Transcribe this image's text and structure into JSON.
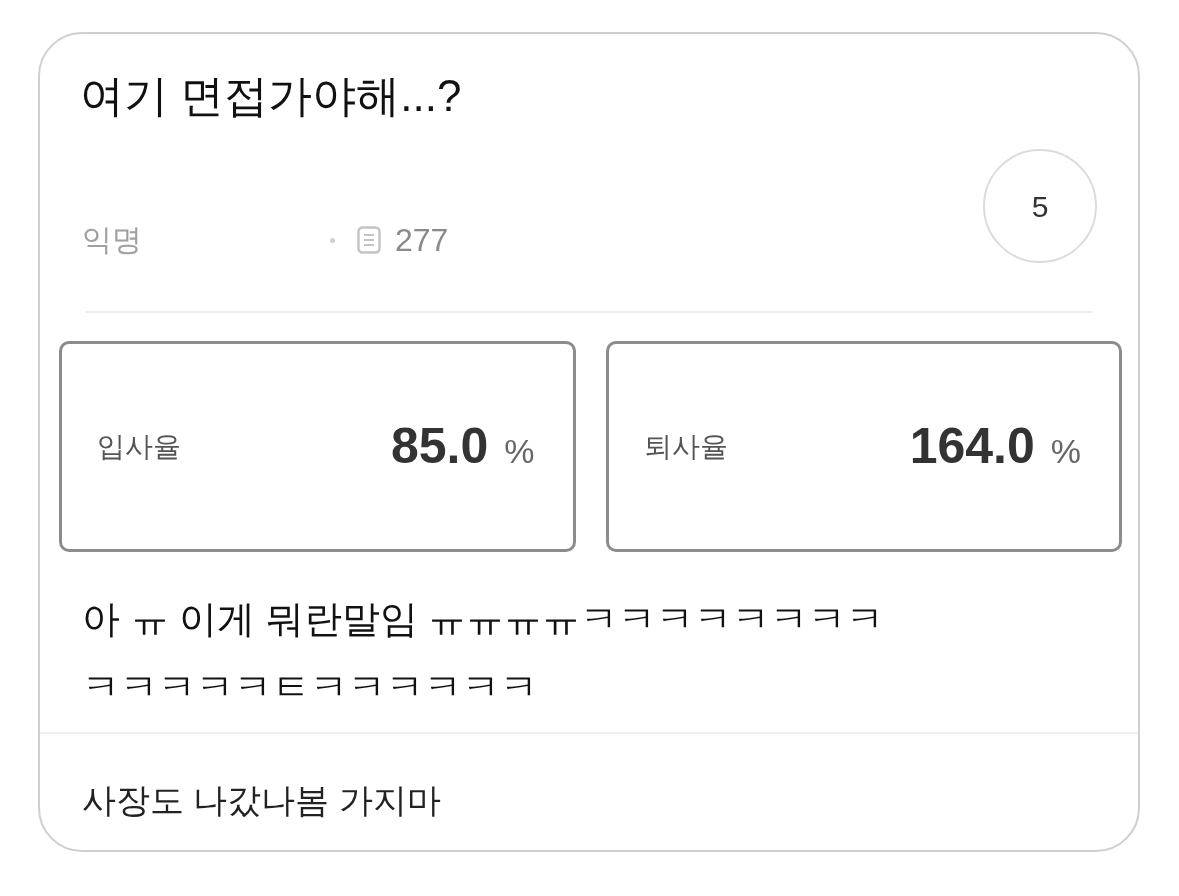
{
  "post": {
    "title": "여기 면접가야해...?",
    "author": "익명",
    "views": "277",
    "count": "5"
  },
  "stats": [
    {
      "label": "입사율",
      "value": "85.0",
      "unit": "%"
    },
    {
      "label": "퇴사율",
      "value": "164.0",
      "unit": "%"
    }
  ],
  "body_lines": [
    "아 ㅠ 이게 뭐란말임 ㅠㅠㅠㅠㅋㅋㅋㅋㅋㅋㅋㅋ",
    "ㅋㅋㅋㅋㅋㅌㅋㅋㅋㅋㅋㅋ"
  ],
  "comment": "사장도 나갔나봄 가지마"
}
